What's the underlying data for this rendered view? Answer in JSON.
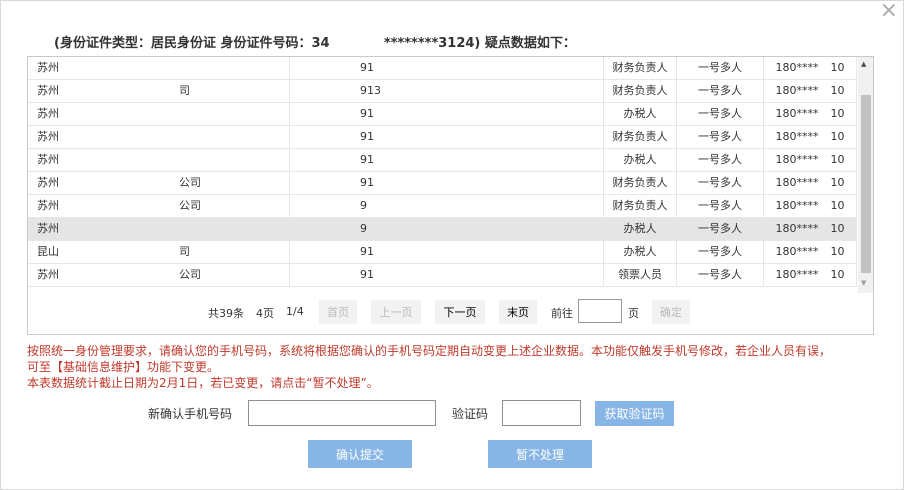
{
  "dialog": {
    "close_glyph": "×",
    "header": "(身份证件类型：居民身份证 身份证件号码：34            ********3124) 疑点数据如下："
  },
  "table": {
    "rows": [
      {
        "c1": "苏州",
        "c2": "91",
        "c3": "财务负责人",
        "c4": "一号多人",
        "c5a": "180****",
        "c5b": "10"
      },
      {
        "c1": "苏州",
        "c1b": "司",
        "c2": "913",
        "c3": "财务负责人",
        "c4": "一号多人",
        "c5a": "180****",
        "c5b": "10"
      },
      {
        "c1": "苏州",
        "c2": "91",
        "c3": "办税人",
        "c4": "一号多人",
        "c5a": "180****",
        "c5b": "10"
      },
      {
        "c1": "苏州",
        "c2": "91",
        "c3": "财务负责人",
        "c4": "一号多人",
        "c5a": "180****",
        "c5b": "10"
      },
      {
        "c1": "苏州",
        "c2": "91",
        "c3": "办税人",
        "c4": "一号多人",
        "c5a": "180****",
        "c5b": "10"
      },
      {
        "c1": "苏州",
        "c1b": "公司",
        "c2": "91",
        "c3": "财务负责人",
        "c4": "一号多人",
        "c5a": "180****",
        "c5b": "10"
      },
      {
        "c1": "苏州",
        "c1b": "公司",
        "c2": "9",
        "c3": "财务负责人",
        "c4": "一号多人",
        "c5a": "180****",
        "c5b": "10"
      },
      {
        "c1": "苏州",
        "c2": "9",
        "c3": "办税人",
        "c4": "一号多人",
        "c5a": "180****",
        "c5b": "10",
        "selected": true
      },
      {
        "c1": "昆山",
        "c1b": "司",
        "c2": "91",
        "c3": "办税人",
        "c4": "一号多人",
        "c5a": "180****",
        "c5b": "10"
      },
      {
        "c1": "苏州",
        "c1b": "公司",
        "c2": "91",
        "c3": "领票人员",
        "c4": "一号多人",
        "c5a": "180****",
        "c5b": "10"
      }
    ]
  },
  "pager": {
    "total": "共39条",
    "pages": "4页",
    "current": "1/4",
    "first": "首页",
    "prev": "上一页",
    "next": "下一页",
    "last": "末页",
    "goto": "前往",
    "page_unit": "页",
    "confirm": "确定"
  },
  "notice": {
    "line1": "按照统一身份管理要求，请确认您的手机号码，系统将根据您确认的手机号码定期自动变更上述企业数据。本功能仅触发手机号修改，若企业人员有误，",
    "line2": "可至【基础信息维护】功能下变更。",
    "line3": "本表数据统计截止日期为2月1日，若已变更，请点击“暂不处理”。"
  },
  "form": {
    "phone_label": "新确认手机号码",
    "phone_value": "",
    "code_label": "验证码",
    "code_value": "",
    "get_code": "获取验证码",
    "submit": "确认提交",
    "skip": "暂不处理"
  }
}
